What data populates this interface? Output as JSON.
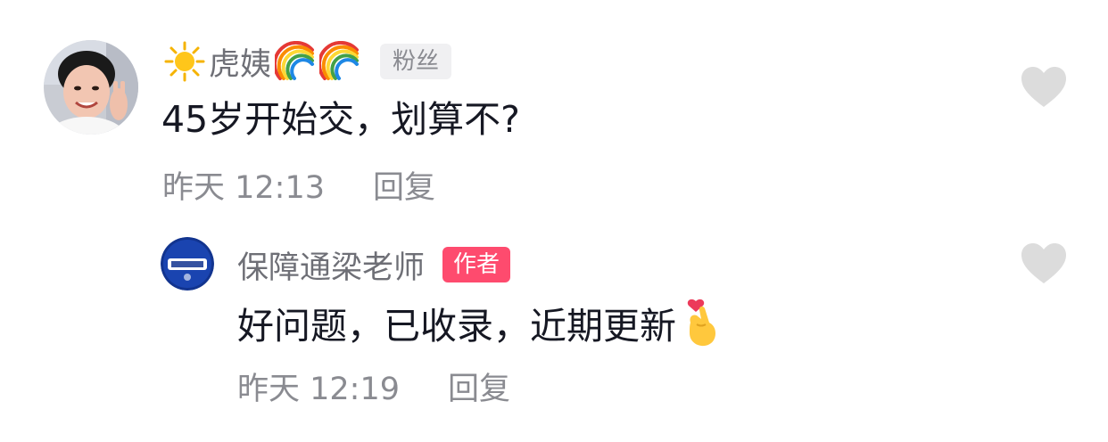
{
  "comment": {
    "avatar_icon": "user-photo-avatar",
    "name_prefix_icon": "sun-emoji-icon",
    "username": "虎姨",
    "name_suffix_icons": [
      "rainbow-emoji-icon",
      "rainbow-emoji-icon"
    ],
    "badge": "粉丝",
    "text": "45岁开始交，划算不?",
    "time": "昨天 12:13",
    "reply_label": "回复",
    "like_icon": "heart-icon"
  },
  "reply": {
    "avatar_icon": "brand-logo-avatar",
    "username": "保障通梁老师",
    "badge": "作者",
    "text": "好问题，已收录，近期更新",
    "text_suffix_icon": "finger-heart-emoji-icon",
    "time": "昨天 12:19",
    "reply_label": "回复",
    "like_icon": "heart-icon"
  },
  "colors": {
    "text_primary": "#161823",
    "text_secondary": "#8a8b91",
    "author_badge": "#fe2c55",
    "fan_badge_bg": "#f0f0f2",
    "heart": "#dcdcdc"
  }
}
